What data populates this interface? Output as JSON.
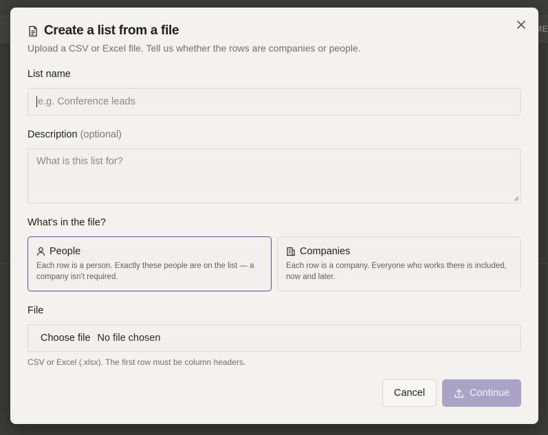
{
  "background": {
    "edge_text": "ME"
  },
  "dialog": {
    "title": "Create a list from a file",
    "subtitle": "Upload a CSV or Excel file. Tell us whether the rows are companies or people."
  },
  "list_name": {
    "label": "List name",
    "placeholder": "e.g. Conference leads",
    "value": ""
  },
  "description": {
    "label": "Description",
    "optional": "(optional)",
    "placeholder": "What is this list for?"
  },
  "content_type": {
    "label": "What's in the file?",
    "selected": "people",
    "options": [
      {
        "id": "people",
        "title": "People",
        "icon": "person-icon",
        "description": "Each row is a person. Exactly these people are on the list — a company isn't required."
      },
      {
        "id": "companies",
        "title": "Companies",
        "icon": "building-icon",
        "description": "Each row is a company. Everyone who works there is included, now and later."
      }
    ]
  },
  "file": {
    "label": "File",
    "button_label": "Choose file",
    "status": "No file chosen",
    "hint": "CSV or Excel (.xlsx). The first row must be column headers."
  },
  "actions": {
    "cancel_label": "Cancel",
    "continue_label": "Continue",
    "continue_disabled": true
  },
  "colors": {
    "accent": "#5a5189",
    "continue_bg": "#a9a3c6",
    "modal_bg": "#f3f2ee"
  }
}
